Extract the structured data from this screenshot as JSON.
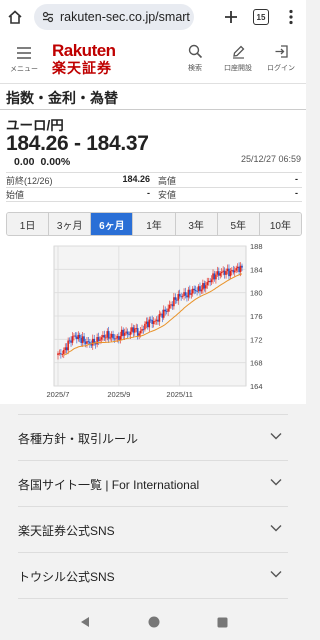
{
  "browser": {
    "url": "rakuten-sec.co.jp/smart",
    "tab_count": "15"
  },
  "header": {
    "menu_label": "メニュー",
    "logo_en": "Rakuten",
    "logo_jp": "楽天証券",
    "search_label": "検索",
    "open_account_label": "口座開設",
    "login_label": "ログイン"
  },
  "page": {
    "section_title": "指数・金利・為替",
    "instrument": "ユーロ/円",
    "price": "184.26 - 184.37",
    "change": "0.00",
    "change_pct": "0.00%",
    "timestamp": "25/12/27 06:59"
  },
  "quote": {
    "prev_close_label": "前終(12/26)",
    "prev_close_value": "184.26",
    "high_label": "高値",
    "high_value": "-",
    "open_label": "始値",
    "open_value": "-",
    "low_label": "安値",
    "low_value": "-"
  },
  "periods": [
    "1日",
    "3ヶ月",
    "6ヶ月",
    "1年",
    "3年",
    "5年",
    "10年"
  ],
  "active_period_index": 2,
  "chart_data": {
    "type": "candlestick",
    "x_tick_labels": [
      "2025/7",
      "2025/9",
      "2025/11"
    ],
    "y_tick_labels": [
      "188",
      "184",
      "180",
      "176",
      "172",
      "168",
      "164"
    ],
    "ylim": [
      164,
      188
    ],
    "grid": true,
    "colors": {
      "up": "#e0251b",
      "down": "#2a56c6",
      "ma": "#e8932a",
      "bg": "#f4f4f4"
    },
    "anchor_closes": [
      169.3,
      169.8,
      171.5,
      172.6,
      172.2,
      171.6,
      171.3,
      171.6,
      172.3,
      172.7,
      172.4,
      172.1,
      173.2,
      172.9,
      173.9,
      172.9,
      174.4,
      175.1,
      175.0,
      176.2,
      176.9,
      178.1,
      179.2,
      179.6,
      179.7,
      180.4,
      180.5,
      181.1,
      182.0,
      183.0,
      183.4,
      183.6,
      183.5,
      184.1,
      184.3
    ],
    "last_close": 184.3
  },
  "footer": {
    "items": [
      "各種方針・取引ルール",
      "各国サイト一覧 | For International",
      "楽天証券公式SNS",
      "トウシル公式SNS"
    ]
  }
}
